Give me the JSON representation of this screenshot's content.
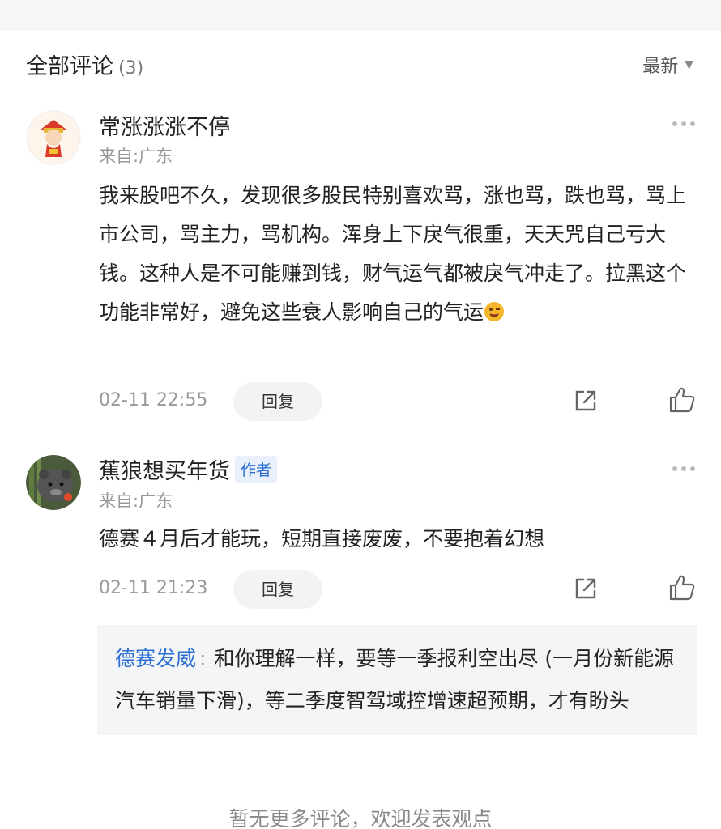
{
  "header": {
    "title": "全部评论",
    "count": "(3)",
    "sort_label": "最新"
  },
  "comments": [
    {
      "name": "常涨涨涨不停",
      "location": "来自:广东",
      "text": "我来股吧不久，发现很多股民特别喜欢骂，涨也骂，跌也骂，骂上市公司，骂主力，骂机构。浑身上下戾气很重，天天咒自己亏大钱。这种人是不可能赚到钱，财气运气都被戾气冲走了。拉黑这个功能非常好，避免这些衰人影响自己的气运",
      "time": "02-11 22:55",
      "reply_label": "回复"
    },
    {
      "name": "蕉狼想买年货",
      "author_tag": "作者",
      "location": "来自:广东",
      "text": "德赛４月后才能玩，短期直接废废，不要抱着幻想",
      "time": "02-11 21:23",
      "reply_label": "回复",
      "sub_reply": {
        "user": "德赛发威",
        "colon": ":",
        "text": "和你理解一样，要等一季报利空出尽 (一月份新能源汽车销量下滑)，等二季度智驾域控增速超预期，才有盼头"
      }
    }
  ],
  "footer": {
    "note": "暂无更多评论，欢迎发表观点"
  }
}
